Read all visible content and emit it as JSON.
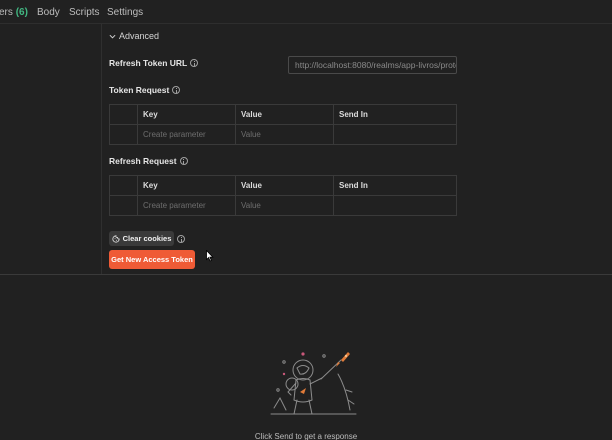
{
  "tabs": [
    {
      "label": "ers",
      "count": "(6)"
    },
    {
      "label": "Body"
    },
    {
      "label": "Scripts"
    },
    {
      "label": "Settings"
    }
  ],
  "advanced": {
    "label": "Advanced",
    "expanded": true
  },
  "refresh_token_url": {
    "label": "Refresh Token URL",
    "value": "http://localhost:8080/realms/app-livros/proto"
  },
  "token_request": {
    "label": "Token Request",
    "columns": [
      "Key",
      "Value",
      "Send In"
    ],
    "placeholder": {
      "key": "Create parameter",
      "value": "Value"
    }
  },
  "refresh_request": {
    "label": "Refresh Request",
    "columns": [
      "Key",
      "Value",
      "Send In"
    ],
    "placeholder": {
      "key": "Create parameter",
      "value": "Value"
    }
  },
  "clear_cookies": {
    "label": "Clear cookies"
  },
  "get_token": {
    "label": "Get New Access Token"
  },
  "response_empty": {
    "message": "Click Send to get a response"
  },
  "colors": {
    "accent": "#ef5b36",
    "count": "#42b883",
    "background": "#212121"
  }
}
